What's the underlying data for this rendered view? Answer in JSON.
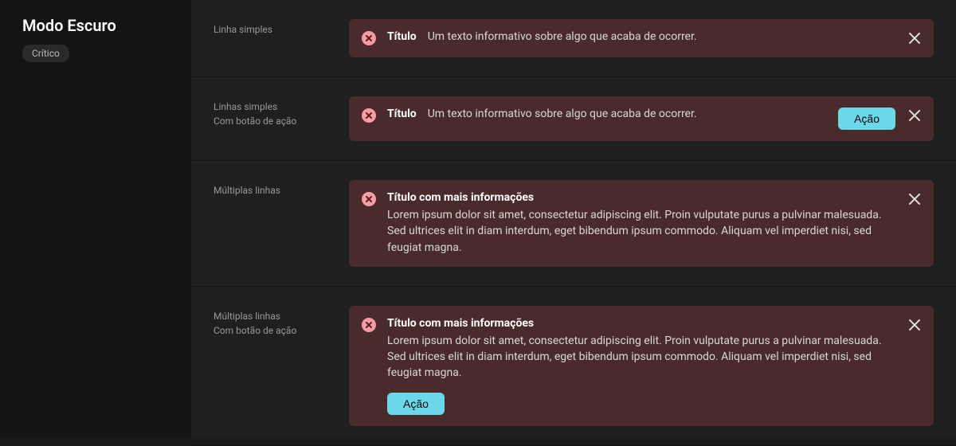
{
  "sidebar": {
    "title": "Modo Escuro",
    "badge": "Crítico"
  },
  "rows": [
    {
      "label_line1": "Linha simples",
      "label_line2": "",
      "alert": {
        "title": "Título",
        "text": "Um texto informativo sobre algo que acaba de ocorrer."
      }
    },
    {
      "label_line1": "Linhas simples",
      "label_line2": "Com botão de ação",
      "alert": {
        "title": "Título",
        "text": "Um texto informativo sobre algo que acaba de ocorrer.",
        "action": "Ação"
      }
    },
    {
      "label_line1": "Múltiplas linhas",
      "label_line2": "",
      "alert": {
        "title": "Título com mais informações",
        "text": "Lorem ipsum dolor sit amet, consectetur adipiscing elit. Proin vulputate purus a pulvinar malesuada. Sed ultrices elit in diam interdum, eget bibendum ipsum commodo. Aliquam vel imperdiet nisi, sed feugiat magna."
      }
    },
    {
      "label_line1": "Múltiplas linhas",
      "label_line2": "Com botão de ação",
      "alert": {
        "title": "Título com mais informações",
        "text": "Lorem ipsum dolor sit amet, consectetur adipiscing elit. Proin vulputate purus a pulvinar malesuada. Sed ultrices elit in diam interdum, eget bibendum ipsum commodo. Aliquam vel imperdiet nisi, sed feugiat magna.",
        "action": "Ação"
      }
    }
  ],
  "colors": {
    "alert_bg": "#4a2b2b",
    "icon_fill": "#f59ca6",
    "action_bg": "#6ad8e8"
  }
}
